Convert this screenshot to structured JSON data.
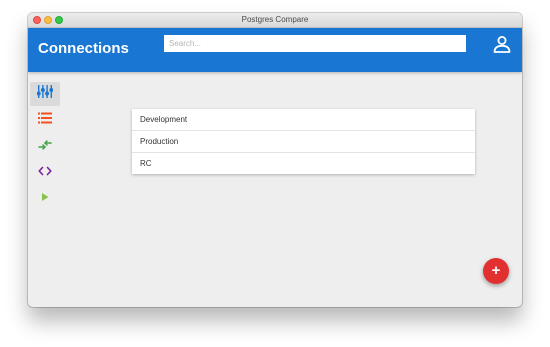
{
  "window": {
    "title": "Postgres Compare"
  },
  "appbar": {
    "title": "Connections",
    "search_placeholder": "Search...",
    "account_icon": "account-icon"
  },
  "sidebar": {
    "items": [
      {
        "icon": "tune-icon",
        "color": "#1976d2",
        "active": true
      },
      {
        "icon": "list-icon",
        "color": "#f4511e",
        "active": false
      },
      {
        "icon": "swap-arrows-icon",
        "color": "#43a047",
        "active": false
      },
      {
        "icon": "code-icon",
        "color": "#7b1fa2",
        "active": false
      },
      {
        "icon": "play-icon",
        "color": "#8bc34a",
        "active": false
      }
    ]
  },
  "connections": [
    {
      "label": "Development"
    },
    {
      "label": "Production"
    },
    {
      "label": "RC"
    }
  ],
  "fab": {
    "label": "+",
    "icon": "add-icon",
    "color": "#e1302f"
  },
  "colors": {
    "primary": "#1976d2",
    "background": "#eeeeee",
    "fab": "#e1302f"
  }
}
